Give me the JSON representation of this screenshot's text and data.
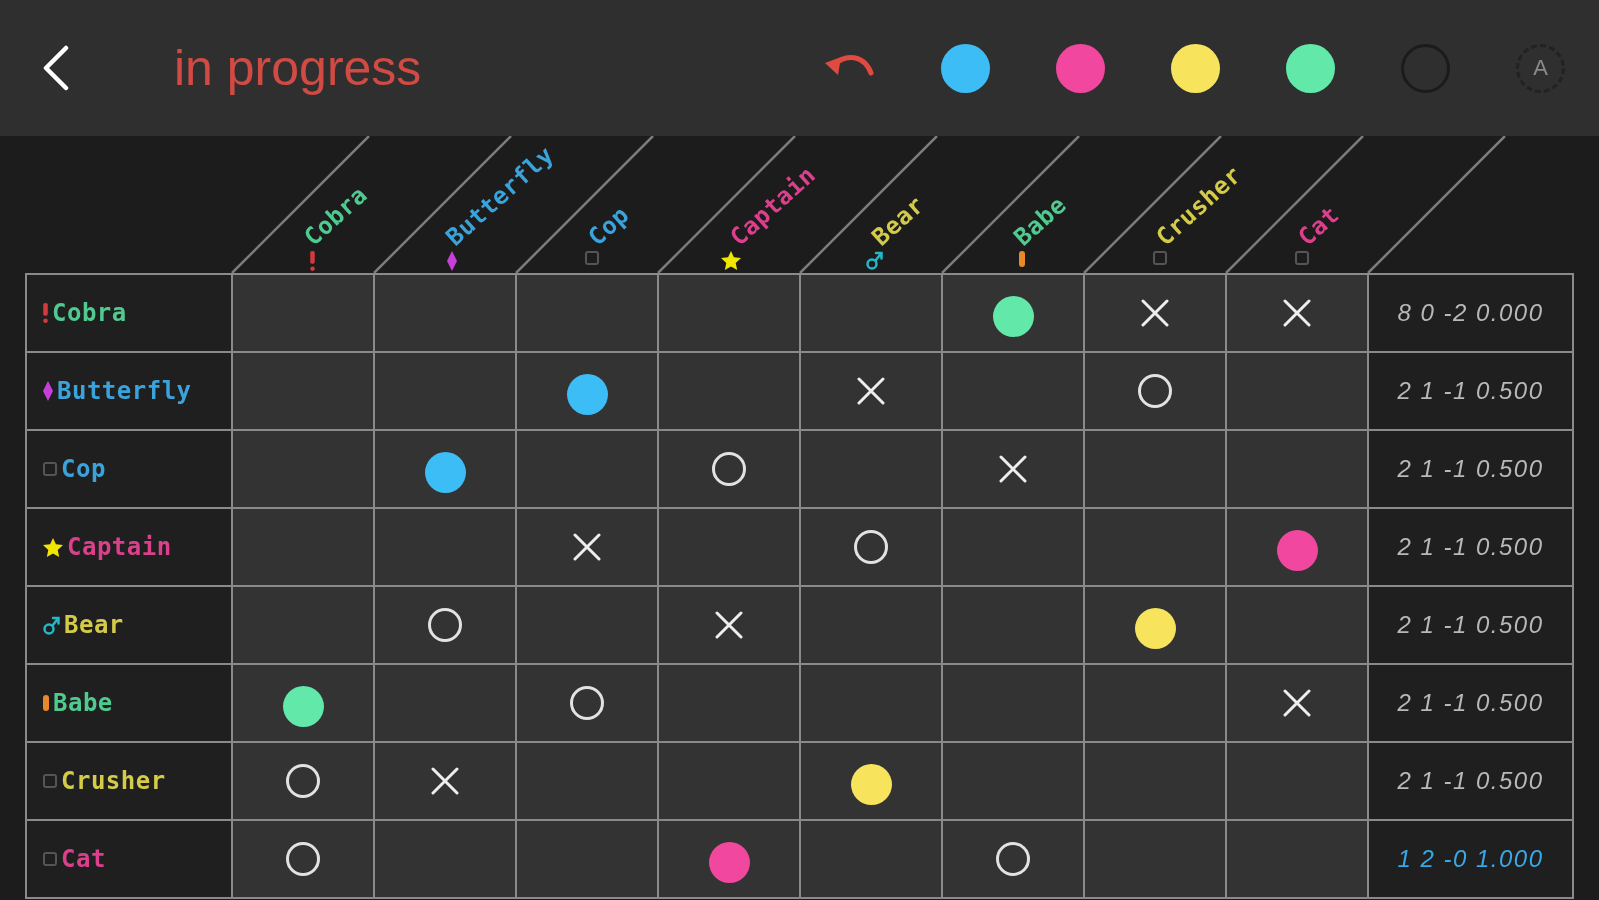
{
  "header": {
    "title": "in progress",
    "palette": [
      {
        "color": "#3dbdf6"
      },
      {
        "color": "#f2479e"
      },
      {
        "color": "#f8e45c"
      },
      {
        "color": "#62e8a8"
      }
    ],
    "auto_button": {
      "label": "A",
      "disabled": true
    }
  },
  "columns": [
    {
      "name": "Cobra",
      "color": "#4fcb8f"
    },
    {
      "name": "Butterfly",
      "color": "#3aa3dc"
    },
    {
      "name": "Cop",
      "color": "#3aa3dc"
    },
    {
      "name": "Captain",
      "color": "#dc3f8c"
    },
    {
      "name": "Bear",
      "color": "#d4cb48"
    },
    {
      "name": "Babe",
      "color": "#4fcb8f"
    },
    {
      "name": "Crusher",
      "color": "#d4cb48"
    },
    {
      "name": "Cat",
      "color": "#dc3f8c"
    }
  ],
  "rows": [
    {
      "name": "Cobra",
      "color": "#4fcb8f",
      "cells": [
        null,
        null,
        null,
        null,
        null,
        {
          "kind": "dot",
          "color": "#62e8a8"
        },
        {
          "kind": "cross"
        },
        {
          "kind": "cross"
        }
      ],
      "score": "8 0 -2 0.000",
      "highlighted": false
    },
    {
      "name": "Butterfly",
      "color": "#3aa3dc",
      "cells": [
        null,
        null,
        {
          "kind": "dot",
          "color": "#3dbdf6"
        },
        null,
        {
          "kind": "cross"
        },
        null,
        {
          "kind": "ring"
        },
        null
      ],
      "score": "2 1 -1 0.500",
      "highlighted": false
    },
    {
      "name": "Cop",
      "color": "#3aa3dc",
      "cells": [
        null,
        {
          "kind": "dot",
          "color": "#3dbdf6"
        },
        null,
        {
          "kind": "ring"
        },
        null,
        {
          "kind": "cross"
        },
        null,
        null
      ],
      "score": "2 1 -1 0.500",
      "highlighted": false
    },
    {
      "name": "Captain",
      "color": "#dc3f8c",
      "cells": [
        null,
        null,
        {
          "kind": "cross"
        },
        null,
        {
          "kind": "ring"
        },
        null,
        null,
        {
          "kind": "dot",
          "color": "#f2479e"
        }
      ],
      "score": "2 1 -1 0.500",
      "highlighted": false
    },
    {
      "name": "Bear",
      "color": "#d4cb48",
      "cells": [
        null,
        {
          "kind": "ring"
        },
        null,
        {
          "kind": "cross"
        },
        null,
        null,
        {
          "kind": "dot",
          "color": "#f8e45c"
        },
        null
      ],
      "score": "2 1 -1 0.500",
      "highlighted": false
    },
    {
      "name": "Babe",
      "color": "#4fcb8f",
      "cells": [
        {
          "kind": "dot",
          "color": "#62e8a8"
        },
        null,
        {
          "kind": "ring"
        },
        null,
        null,
        null,
        null,
        {
          "kind": "cross"
        }
      ],
      "score": "2 1 -1 0.500",
      "highlighted": false
    },
    {
      "name": "Crusher",
      "color": "#d4cb48",
      "cells": [
        {
          "kind": "ring"
        },
        {
          "kind": "cross"
        },
        null,
        null,
        {
          "kind": "dot",
          "color": "#f8e45c"
        },
        null,
        null,
        null
      ],
      "score": "2 1 -1 0.500",
      "highlighted": false
    },
    {
      "name": "Cat",
      "color": "#dc3f8c",
      "cells": [
        {
          "kind": "ring"
        },
        null,
        null,
        {
          "kind": "dot",
          "color": "#f2479e"
        },
        null,
        {
          "kind": "ring"
        },
        null,
        null
      ],
      "score": "1 2 -0 1.000",
      "highlighted": true
    }
  ]
}
